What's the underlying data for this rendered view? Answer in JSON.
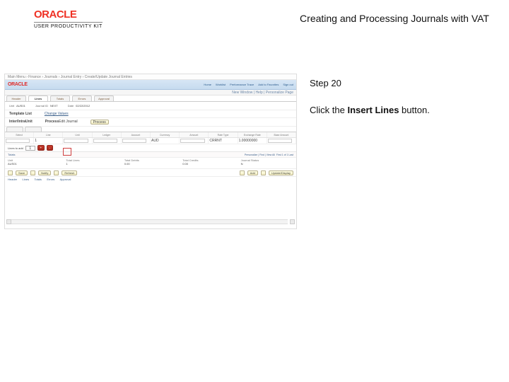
{
  "header": {
    "logo_text": "ORACLE",
    "logo_subtitle": "USER PRODUCTIVITY KIT",
    "page_title": "Creating and Processing Journals with VAT"
  },
  "instructions": {
    "step_label": "Step 20",
    "text_prefix": "Click the ",
    "button_name": "Insert Lines",
    "text_suffix": " button."
  },
  "screenshot": {
    "topbar": "Main Menu › Finance › Journals › Journal Entry › Create/Update Journal Entries",
    "banner_logo": "ORACLE",
    "banner_links": [
      "Home",
      "Worklist",
      "Performance Trace",
      "Add to Favorites",
      "Sign out"
    ],
    "subbar": "New Window | Help | Personalize Page",
    "tabs": [
      "Header",
      "Lines",
      "Totals",
      "Errors",
      "Approval"
    ],
    "tabs_active": 1,
    "form": {
      "unit_label": "Unit",
      "unit_value": "AUS01",
      "journal_label": "Journal ID",
      "journal_value": "NEXT",
      "date_label": "Date",
      "date_value": "02/22/2012"
    },
    "form2": {
      "template_label": "Template List",
      "change_values": "Change Values",
      "inter_label": "Inter/IntraUnit",
      "process_label": "Process",
      "process_value": "Edit Journal",
      "process_button": "Process"
    },
    "grid_cols": [
      "Select",
      "Line",
      "Unit",
      "Ledger",
      "Account",
      "Currency",
      "Amount",
      "Rate Type",
      "Exchange Rate",
      "Base Amount"
    ],
    "grid_row": [
      "",
      "1",
      "",
      "",
      "",
      "AUD",
      "",
      "CRRNT",
      "1.00000000",
      ""
    ],
    "insert": {
      "label": "Lines to add",
      "value": "1",
      "buttons": [
        "+",
        "-"
      ]
    },
    "totals": {
      "header_left": "Totals",
      "header_right_links": "Personalize | Find | View All",
      "header_right_range": "First 1 of 1 Last",
      "cols": [
        "Unit",
        "Total Lines",
        "Total Debits",
        "Total Credits",
        "Journal Status"
      ],
      "row": [
        "AUS01",
        "1",
        "0.00",
        "0.00",
        "N"
      ]
    },
    "actions": {
      "save": "Save",
      "notify": "Notify",
      "refresh": "Refresh",
      "add": "Add",
      "update": "Update/Display"
    },
    "bottom_links": [
      "Header",
      "Lines",
      "Totals",
      "Errors",
      "Approval"
    ]
  }
}
